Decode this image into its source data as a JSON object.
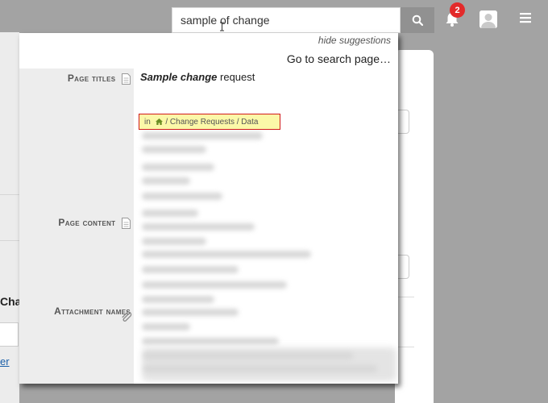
{
  "search": {
    "value": "sample of change"
  },
  "notifications": {
    "count": "2"
  },
  "suggestions": {
    "hide_label": "hide suggestions",
    "goto_label": "Go to search page…",
    "sections": {
      "page_titles": "Page titles",
      "page_content": "Page content",
      "attachment_names": "Attachment names"
    },
    "first_result": {
      "title_match1": "Sample",
      "title_match2": "change",
      "title_rest": "request",
      "breadcrumb_prefix": "in",
      "breadcrumb_path": "/ Change Requests / Data"
    }
  },
  "background": {
    "partial_heading": "Cha",
    "partial_link": "er"
  },
  "colors": {
    "badge": "#e32a2a",
    "breadcrumb_highlight": "#fbf8a8",
    "breadcrumb_border": "#d11a1a"
  },
  "icons": [
    "search-icon",
    "bell-icon",
    "avatar-icon",
    "menu-icon",
    "page-icon",
    "paperclip-icon",
    "home-icon"
  ]
}
